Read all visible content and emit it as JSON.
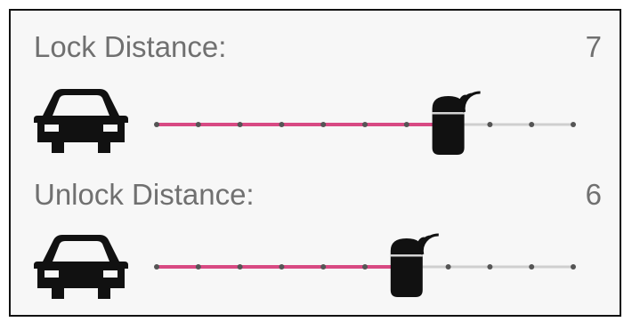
{
  "colors": {
    "active_track": "#d84a83",
    "inactive_track": "#cfcfcf",
    "tick": "#555555",
    "label_text": "#707070",
    "icon": "#111111",
    "panel_bg": "#f7f7f7"
  },
  "sliders": [
    {
      "label": "Lock Distance:",
      "value_text": "7",
      "value": 7,
      "min": 0,
      "max": 10,
      "car_icon": "car-icon",
      "thumb_icon": "key-fob-signal-icon"
    },
    {
      "label": "Unlock Distance:",
      "value_text": "6",
      "value": 6,
      "min": 0,
      "max": 10,
      "car_icon": "car-icon",
      "thumb_icon": "key-fob-signal-icon"
    }
  ]
}
